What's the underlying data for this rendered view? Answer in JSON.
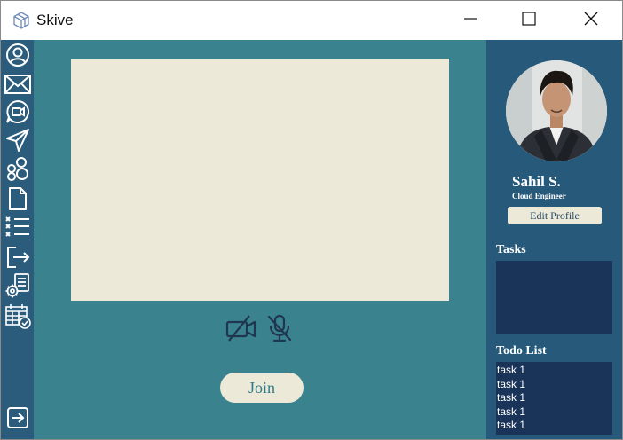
{
  "window": {
    "title": "Skive",
    "app_icon": "skive-cube-icon",
    "controls": [
      "minimize-icon",
      "maximize-icon",
      "close-icon"
    ]
  },
  "sidebar": {
    "items": [
      {
        "icon": "user-circle-icon"
      },
      {
        "icon": "mail-icon"
      },
      {
        "icon": "video-chat-icon"
      },
      {
        "icon": "send-icon"
      },
      {
        "icon": "group-icon"
      },
      {
        "icon": "document-icon"
      },
      {
        "icon": "checklist-icon"
      },
      {
        "icon": "logout-icon"
      },
      {
        "icon": "settings-document-icon"
      },
      {
        "icon": "calendar-check-icon"
      }
    ],
    "bottom_icon": "exit-arrow-icon"
  },
  "meeting": {
    "camera_icon": "camera-off-icon",
    "mic_icon": "mic-off-icon",
    "join_label": "Join"
  },
  "profile": {
    "name": "Sahil S.",
    "role": "Cloud Engineer",
    "edit_label": "Edit Profile"
  },
  "tasks": {
    "title": "Tasks",
    "items": []
  },
  "todo": {
    "title": "Todo List",
    "items": [
      "task 1",
      "task 1",
      "task 1",
      "task 1",
      "task 1"
    ]
  },
  "colors": {
    "sidebar": "#2b5c7c",
    "main": "#3a838e",
    "right_panel": "#275a7a",
    "panel_box": "#1a3358",
    "cream": "#ece9d8"
  }
}
